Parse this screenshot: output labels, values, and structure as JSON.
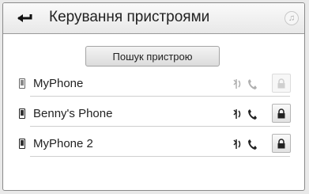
{
  "header": {
    "title": "Керування пристроями"
  },
  "search_button": {
    "label": "Пошук пристрою"
  },
  "devices": [
    {
      "name": "MyPhone",
      "state": "inactive"
    },
    {
      "name": "Benny's Phone",
      "state": "active"
    },
    {
      "name": "MyPhone 2",
      "state": "active"
    }
  ],
  "icons": {
    "back": "back-arrow-icon",
    "music": "music-note-icon",
    "phone": "phone-device-icon",
    "audio_service": "audio-service-icon",
    "call_service": "call-service-icon",
    "lock": "lock-icon"
  },
  "colors": {
    "background": "#ffffff",
    "header": "#efefef",
    "active_icon": "#222222",
    "inactive_icon": "#b0b0b0"
  }
}
